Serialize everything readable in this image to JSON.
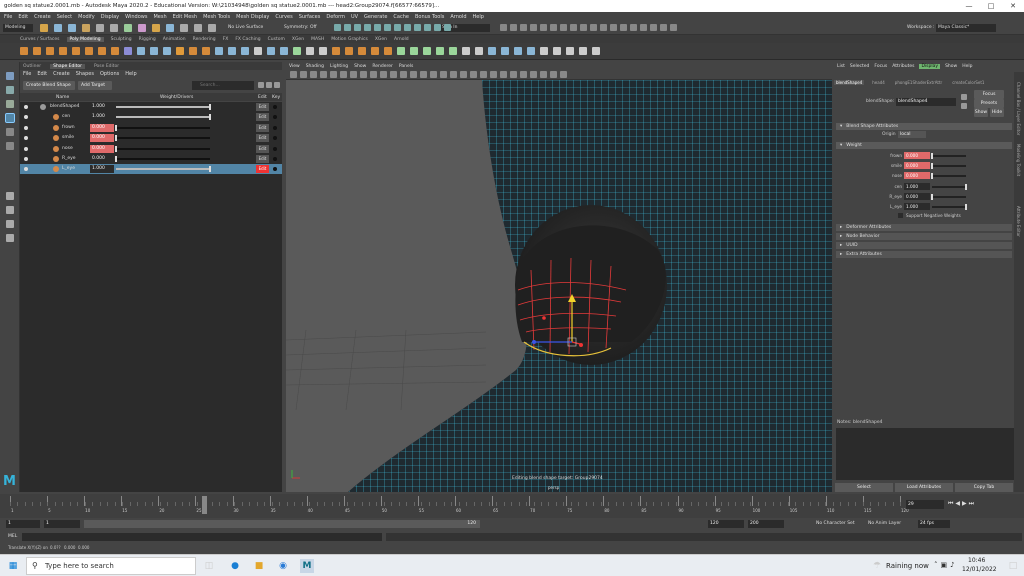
{
  "window": {
    "title": "golden sq statue2.0001.mb - Autodesk Maya 2020.2 - Educational Version: W:\\21034948\\golden sq statue2.0001.mb  ---  head2:Group29074.f[66577:66579]..."
  },
  "menubar": [
    "File",
    "Edit",
    "Create",
    "Select",
    "Modify",
    "Display",
    "Windows",
    "Mesh",
    "Edit Mesh",
    "Mesh Tools",
    "Mesh Display",
    "Curves",
    "Surfaces",
    "Deform",
    "UV",
    "Generate",
    "Cache",
    "Bonus Tools",
    "Arnold",
    "Help"
  ],
  "status": {
    "mode": "Modeling",
    "live_surface": "No Live Surface",
    "symmetry": "Symmetry: Off",
    "signin": "Sign In",
    "workspace_label": "Workspace :",
    "workspace_value": "Maya Classic*"
  },
  "shelf_tabs": [
    "Curves / Surfaces",
    "Poly Modeling",
    "Sculpting",
    "Rigging",
    "Animation",
    "Rendering",
    "FX",
    "FX Caching",
    "Custom",
    "XGen",
    "MASH",
    "Motion Graphics",
    "XGen",
    "Arnold"
  ],
  "shelf_active": "Poly Modeling",
  "outliner_tabs": [
    "Outliner",
    "Shape Editor",
    "Pose Editor"
  ],
  "outliner_active": "Shape Editor",
  "shape_menu": [
    "File",
    "Edit",
    "Create",
    "Shapes",
    "Options",
    "Help"
  ],
  "shape_toolbar": {
    "create_button": "Create Blend Shape",
    "add_target_button": "Add Target",
    "search_placeholder": "Search..."
  },
  "shape_columns": {
    "name": "Name",
    "weight": "Weight/Drivers",
    "edit": "Edit",
    "key": "Key"
  },
  "shape_rows": [
    {
      "name": "blendShape4",
      "weight": "1.000",
      "fill": 1.0,
      "keyed": false,
      "edit": false,
      "selected": false
    },
    {
      "name": "cen",
      "weight": "1.000",
      "fill": 1.0,
      "keyed": false,
      "edit": true,
      "selected": false
    },
    {
      "name": "frown",
      "weight": "0.000",
      "fill": 0.0,
      "keyed": true,
      "edit": true,
      "selected": false
    },
    {
      "name": "smile",
      "weight": "0.000",
      "fill": 0.0,
      "keyed": true,
      "edit": true,
      "selected": false
    },
    {
      "name": "nose",
      "weight": "0.000",
      "fill": 0.0,
      "keyed": true,
      "edit": true,
      "selected": false
    },
    {
      "name": "R_eye",
      "weight": "0.000",
      "fill": 0.0,
      "keyed": false,
      "edit": true,
      "selected": false
    },
    {
      "name": "L_eye",
      "weight": "1.000",
      "fill": 1.0,
      "keyed": false,
      "edit": true,
      "selected": true
    }
  ],
  "viewport_menu": [
    "View",
    "Shading",
    "Lighting",
    "Show",
    "Renderer",
    "Panels"
  ],
  "viewport_status": {
    "line1": "Editing blend shape target: Group29074",
    "line2": "persp"
  },
  "attr_menu": [
    "List",
    "Selected",
    "Focus",
    "Attributes",
    "Display",
    "Show",
    "Help"
  ],
  "attr_focus": "Display",
  "attr_tabs": [
    "blendShape4",
    "head4",
    "phongE1ShaderExtrAttr",
    "createColorSet1"
  ],
  "attr": {
    "blendshape_label": "blendShape:",
    "blendshape_value": "blendShape4",
    "focus_button": "Focus",
    "presets_button": "Presets",
    "show_button": "Show",
    "hide_button": "Hide",
    "sec_attributes": "Blend Shape Attributes",
    "origin_label": "Origin",
    "origin_value": "local",
    "sec_weight": "Weight",
    "weights": [
      {
        "label": "frown",
        "value": "0.000",
        "keyed": true,
        "level": 0.0
      },
      {
        "label": "smile",
        "value": "0.000",
        "keyed": true,
        "level": 0.0
      },
      {
        "label": "nose",
        "value": "0.000",
        "keyed": true,
        "level": 0.0
      },
      {
        "label": "cen",
        "value": "1.000",
        "keyed": false,
        "level": 1.0
      },
      {
        "label": "R_eye",
        "value": "0.000",
        "keyed": false,
        "level": 0.0
      },
      {
        "label": "L_eye",
        "value": "1.000",
        "keyed": false,
        "level": 1.0
      }
    ],
    "support_negative": "Support Negative Weights",
    "collapsed_sections": [
      "Deformer Attributes",
      "Node Behavior",
      "UUID",
      "Extra Attributes"
    ],
    "notes_label": "Notes: blendShape4",
    "bottom_buttons": [
      "Select",
      "Load Attributes",
      "Copy Tab"
    ]
  },
  "side_tabs": [
    "Channel Box / Layer Editor",
    "Modeling Toolkit",
    "Attribute Editor"
  ],
  "timeline": {
    "ticks": [
      "1",
      "5",
      "10",
      "15",
      "20",
      "25",
      "30",
      "35",
      "40",
      "45",
      "50",
      "55",
      "60",
      "65",
      "70",
      "75",
      "80",
      "85",
      "90",
      "95",
      "100",
      "105",
      "110",
      "115",
      "120"
    ],
    "current_frame": "29"
  },
  "range": {
    "start": "1",
    "start2": "1",
    "end_slider": "120",
    "end": "120",
    "end2": "200",
    "character_set": "No Character Set",
    "anim_layer": "No Anim Layer",
    "fps": "24 fps"
  },
  "cmd": {
    "label": "MEL"
  },
  "help_line": [
    "Translate X(Y)(Z) on",
    "0.0??",
    "0.000",
    "0.000"
  ],
  "taskbar": {
    "search_placeholder": "Type here to search",
    "weather": "Raining now",
    "time": "10:46",
    "date": "12/01/2022"
  }
}
